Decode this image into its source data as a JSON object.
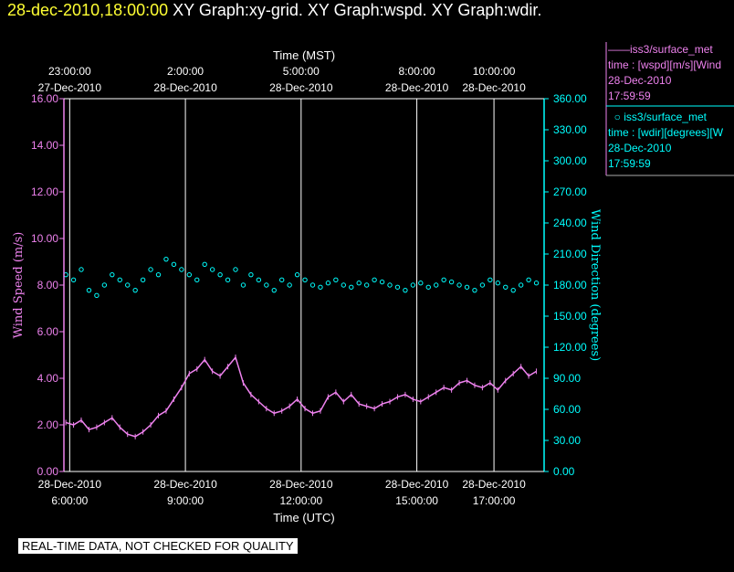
{
  "header": {
    "timestamp": "28-dec-2010,18:00:00",
    "graphs": "XY Graph:xy-grid.  XY Graph:wspd.  XY Graph:wdir."
  },
  "legend": {
    "wspd": {
      "series": "iss3/surface_met",
      "var": "time : [wspd][m/s][Wind",
      "date": "28-Dec-2010",
      "time": "17:59:59"
    },
    "wdir": {
      "series": "iss3/surface_met",
      "var": "time : [wdir][degrees][W",
      "date": "28-Dec-2010",
      "time": "17:59:59"
    }
  },
  "disclaimer": "REAL-TIME DATA, NOT CHECKED FOR QUALITY",
  "colors": {
    "wspd": "#ee82ee",
    "wdir": "#00ffff",
    "grid": "#ffffff",
    "title_time": "#ffff33"
  },
  "chart_data": {
    "type": "line",
    "title": "",
    "xlabel_bottom": "Time (UTC)",
    "xlabel_top": "Time (MST)",
    "ylabel_left": "Wind Speed (m/s)",
    "ylabel_right": "Wind Direction (degrees)",
    "xlim_utc_hours": [
      5.85,
      18.3
    ],
    "ylim_left": [
      0,
      16
    ],
    "ylim_right": [
      0,
      360
    ],
    "grid": true,
    "bottom_ticks": [
      {
        "hour": 6,
        "label1": "28-Dec-2010",
        "label2": "6:00:00"
      },
      {
        "hour": 9,
        "label1": "28-Dec-2010",
        "label2": "9:00:00"
      },
      {
        "hour": 12,
        "label1": "28-Dec-2010",
        "label2": "12:00:00"
      },
      {
        "hour": 15,
        "label1": "28-Dec-2010",
        "label2": "15:00:00"
      },
      {
        "hour": 17,
        "label1": "28-Dec-2010",
        "label2": "17:00:00"
      }
    ],
    "top_ticks": [
      {
        "hour": 6,
        "label1": "23:00:00",
        "label2": "27-Dec-2010"
      },
      {
        "hour": 9,
        "label1": "2:00:00",
        "label2": "28-Dec-2010"
      },
      {
        "hour": 12,
        "label1": "5:00:00",
        "label2": "28-Dec-2010"
      },
      {
        "hour": 15,
        "label1": "8:00:00",
        "label2": "28-Dec-2010"
      },
      {
        "hour": 17,
        "label1": "10:00:00",
        "label2": "28-Dec-2010"
      }
    ],
    "left_ticks": [
      "0.00",
      "2.00",
      "4.00",
      "6.00",
      "8.00",
      "10.00",
      "12.00",
      "14.00",
      "16.00"
    ],
    "right_ticks": [
      "0.00",
      "30.00",
      "60.00",
      "90.00",
      "120.00",
      "150.00",
      "180.00",
      "210.00",
      "240.00",
      "270.00",
      "300.00",
      "330.00",
      "360.00"
    ],
    "series": [
      {
        "name": "iss3/surface_met wspd",
        "style": "line",
        "axis": "left",
        "x": [
          5.9,
          6.1,
          6.3,
          6.5,
          6.7,
          6.9,
          7.1,
          7.3,
          7.5,
          7.7,
          7.9,
          8.1,
          8.3,
          8.5,
          8.7,
          8.9,
          9.1,
          9.3,
          9.5,
          9.7,
          9.9,
          10.1,
          10.3,
          10.5,
          10.7,
          10.9,
          11.1,
          11.3,
          11.5,
          11.7,
          11.9,
          12.1,
          12.3,
          12.5,
          12.7,
          12.9,
          13.1,
          13.3,
          13.5,
          13.7,
          13.9,
          14.1,
          14.3,
          14.5,
          14.7,
          14.9,
          15.1,
          15.3,
          15.5,
          15.7,
          15.9,
          16.1,
          16.3,
          16.5,
          16.7,
          16.9,
          17.1,
          17.3,
          17.5,
          17.7,
          17.9,
          18.1
        ],
        "values": [
          2.1,
          2.0,
          2.2,
          1.8,
          1.9,
          2.1,
          2.3,
          1.9,
          1.6,
          1.5,
          1.7,
          2.0,
          2.4,
          2.6,
          3.1,
          3.6,
          4.2,
          4.4,
          4.8,
          4.3,
          4.1,
          4.5,
          4.9,
          3.8,
          3.3,
          3.0,
          2.7,
          2.5,
          2.6,
          2.8,
          3.1,
          2.7,
          2.5,
          2.6,
          3.2,
          3.4,
          3.0,
          3.3,
          2.9,
          2.8,
          2.7,
          2.9,
          3.0,
          3.2,
          3.3,
          3.1,
          3.0,
          3.2,
          3.4,
          3.6,
          3.5,
          3.8,
          3.9,
          3.7,
          3.6,
          3.8,
          3.5,
          3.9,
          4.2,
          4.5,
          4.1,
          4.3
        ]
      },
      {
        "name": "iss3/surface_met wdir",
        "style": "markers",
        "axis": "right",
        "x": [
          5.9,
          6.1,
          6.3,
          6.5,
          6.7,
          6.9,
          7.1,
          7.3,
          7.5,
          7.7,
          7.9,
          8.1,
          8.3,
          8.5,
          8.7,
          8.9,
          9.1,
          9.3,
          9.5,
          9.7,
          9.9,
          10.1,
          10.3,
          10.5,
          10.7,
          10.9,
          11.1,
          11.3,
          11.5,
          11.7,
          11.9,
          12.1,
          12.3,
          12.5,
          12.7,
          12.9,
          13.1,
          13.3,
          13.5,
          13.7,
          13.9,
          14.1,
          14.3,
          14.5,
          14.7,
          14.9,
          15.1,
          15.3,
          15.5,
          15.7,
          15.9,
          16.1,
          16.3,
          16.5,
          16.7,
          16.9,
          17.1,
          17.3,
          17.5,
          17.7,
          17.9,
          18.1
        ],
        "values": [
          190,
          185,
          195,
          175,
          170,
          180,
          190,
          185,
          180,
          175,
          185,
          195,
          190,
          205,
          200,
          195,
          190,
          185,
          200,
          195,
          190,
          185,
          195,
          180,
          190,
          185,
          180,
          175,
          185,
          180,
          190,
          185,
          180,
          178,
          182,
          185,
          180,
          178,
          182,
          180,
          185,
          183,
          180,
          178,
          175,
          180,
          182,
          178,
          180,
          185,
          183,
          180,
          178,
          175,
          180,
          185,
          182,
          178,
          175,
          180,
          185,
          182
        ]
      }
    ]
  }
}
